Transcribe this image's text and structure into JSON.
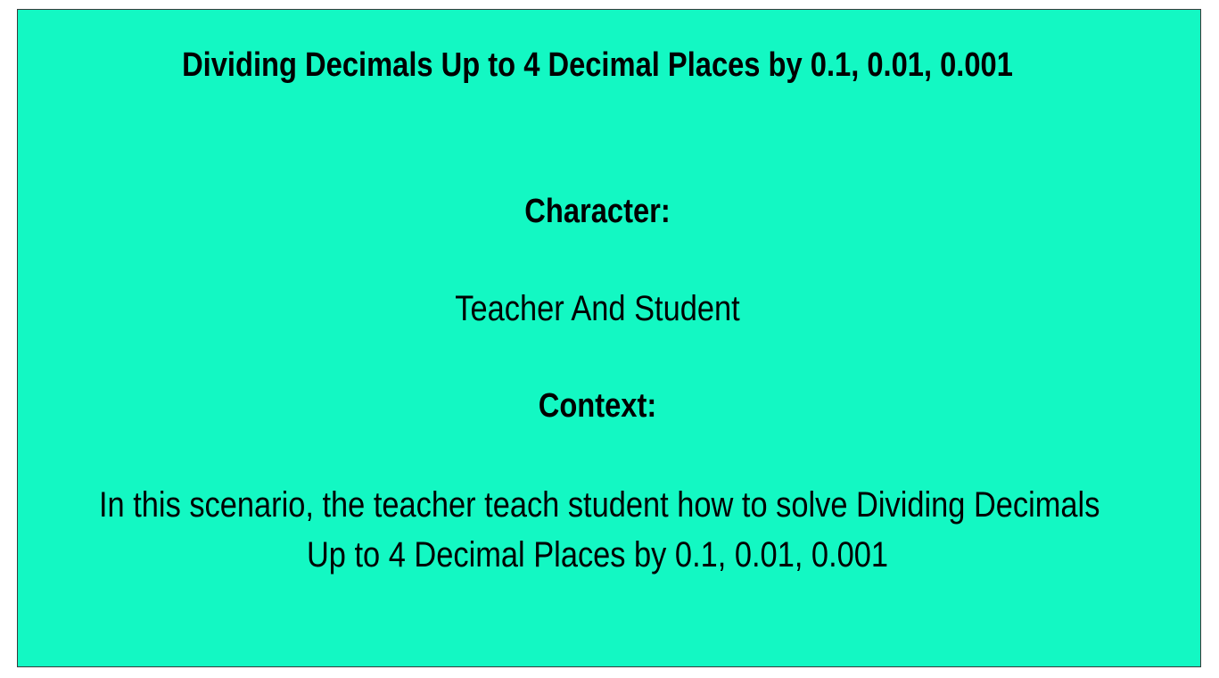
{
  "slide": {
    "title": "Dividing Decimals Up to 4 Decimal Places by 0.1, 0.01, 0.001",
    "character_heading": "Character:",
    "character_text": "Teacher And Student",
    "context_heading": "Context:",
    "context_line_1": "In this scenario, the teacher teach student how to solve Dividing Decimals",
    "context_line_2": "Up to 4 Decimal Places by 0.1, 0.01, 0.001"
  },
  "colors": {
    "background": "#13f8c3",
    "text": "#000000",
    "border": "#3a3a3a"
  }
}
